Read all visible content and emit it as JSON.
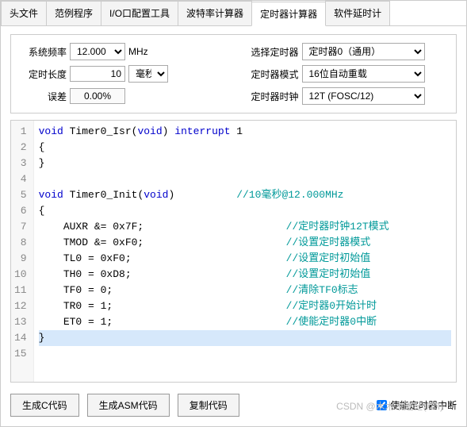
{
  "tabs": {
    "header": "头文件",
    "example": "范例程序",
    "io": "I/O口配置工具",
    "baud": "波特率计算器",
    "timer": "定时器计算器",
    "delay": "软件延时计"
  },
  "form": {
    "freq_label": "系统频率",
    "freq_value": "12.000",
    "freq_unit": "MHz",
    "len_label": "定时长度",
    "len_value": "10",
    "len_unit": "毫秒",
    "err_label": "误差",
    "err_value": "0.00%",
    "sel_timer_label": "选择定时器",
    "sel_timer_value": "定时器0（通用）",
    "mode_label": "定时器模式",
    "mode_value": "16位自动重载",
    "clock_label": "定时器时钟",
    "clock_value": "12T (FOSC/12)"
  },
  "code": {
    "lines": [
      "void Timer0_Isr(void) interrupt 1",
      "{",
      "}",
      "",
      "void Timer0_Init(void)\t\t//10毫秒@12.000MHz",
      "{",
      "    AUXR &= 0x7F;\t\t\t//定时器时钟12T模式",
      "    TMOD &= 0xF0;\t\t\t//设置定时器模式",
      "    TL0 = 0xF0;\t\t\t\t//设置定时初始值",
      "    TH0 = 0xD8;\t\t\t\t//设置定时初始值",
      "    TF0 = 0;\t\t\t\t//清除TF0标志",
      "    TR0 = 1;\t\t\t\t//定时器0开始计时",
      "    ET0 = 1;\t\t\t\t//使能定时器0中断",
      "}",
      ""
    ]
  },
  "buttons": {
    "gen_c": "生成C代码",
    "gen_asm": "生成ASM代码",
    "copy": "复制代码",
    "enable_int": "使能定时器中断"
  },
  "watermark": "CSDN @木木木迷茫(ΠΠ)"
}
